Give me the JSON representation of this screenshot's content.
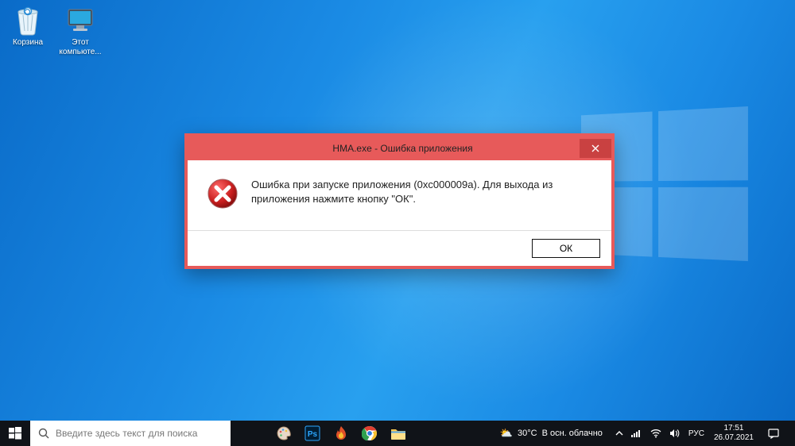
{
  "desktop": {
    "icons": [
      {
        "name": "recycle-bin",
        "label": "Корзина"
      },
      {
        "name": "this-pc",
        "label": "Этот компьюте..."
      }
    ]
  },
  "dialog": {
    "title": "HMA.exe - Ошибка приложения",
    "message": "Ошибка при запуске приложения (0xc000009a). Для выхода из приложения нажмите кнопку \"ОК\".",
    "ok_label": "ОК",
    "icon": "error-icon"
  },
  "taskbar": {
    "search_placeholder": "Введите здесь текст для поиска",
    "pinned": [
      {
        "name": "paint-app",
        "glyph": "paint"
      },
      {
        "name": "photoshop-app",
        "glyph": "ps"
      },
      {
        "name": "ccleaner-app",
        "glyph": "flame"
      },
      {
        "name": "chrome-app",
        "glyph": "chrome"
      },
      {
        "name": "file-explorer",
        "glyph": "folder"
      }
    ],
    "weather": {
      "temp": "30°C",
      "desc": "В осн. облачно"
    },
    "language": "РУС",
    "time": "17:51",
    "date": "26.07.2021"
  },
  "colors": {
    "dialog_border": "#e75a5a",
    "close_button": "#c94141",
    "taskbar_bg": "#101318",
    "desktop_blue": "#1a8ae4"
  }
}
